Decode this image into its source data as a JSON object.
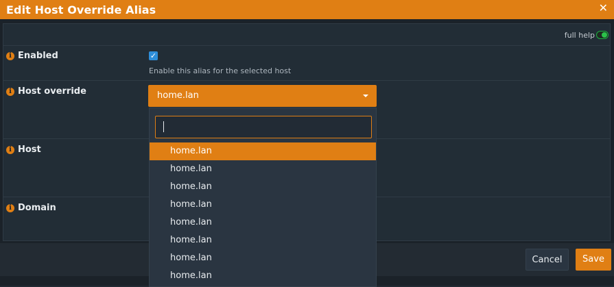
{
  "dialog": {
    "title": "Edit Host Override Alias",
    "close_glyph": "✕"
  },
  "full_help": {
    "label": "full help",
    "enabled": true
  },
  "fields": {
    "enabled": {
      "label": "Enabled",
      "checked": true,
      "help": "Enable this alias for the selected host"
    },
    "host_override": {
      "label": "Host override",
      "value": "home.lan"
    },
    "host": {
      "label": "Host"
    },
    "domain": {
      "label": "Domain"
    }
  },
  "dropdown": {
    "search_placeholder": "",
    "items": [
      "home.lan",
      "home.lan",
      "home.lan",
      "home.lan",
      "home.lan",
      "home.lan",
      "home.lan",
      "home.lan"
    ],
    "active_index": 0
  },
  "buttons": {
    "cancel": "Cancel",
    "save": "Save"
  },
  "colors": {
    "accent": "#e07f14",
    "background": "#1b2229",
    "panel": "#222d36",
    "toggle_on": "#1bb341"
  }
}
